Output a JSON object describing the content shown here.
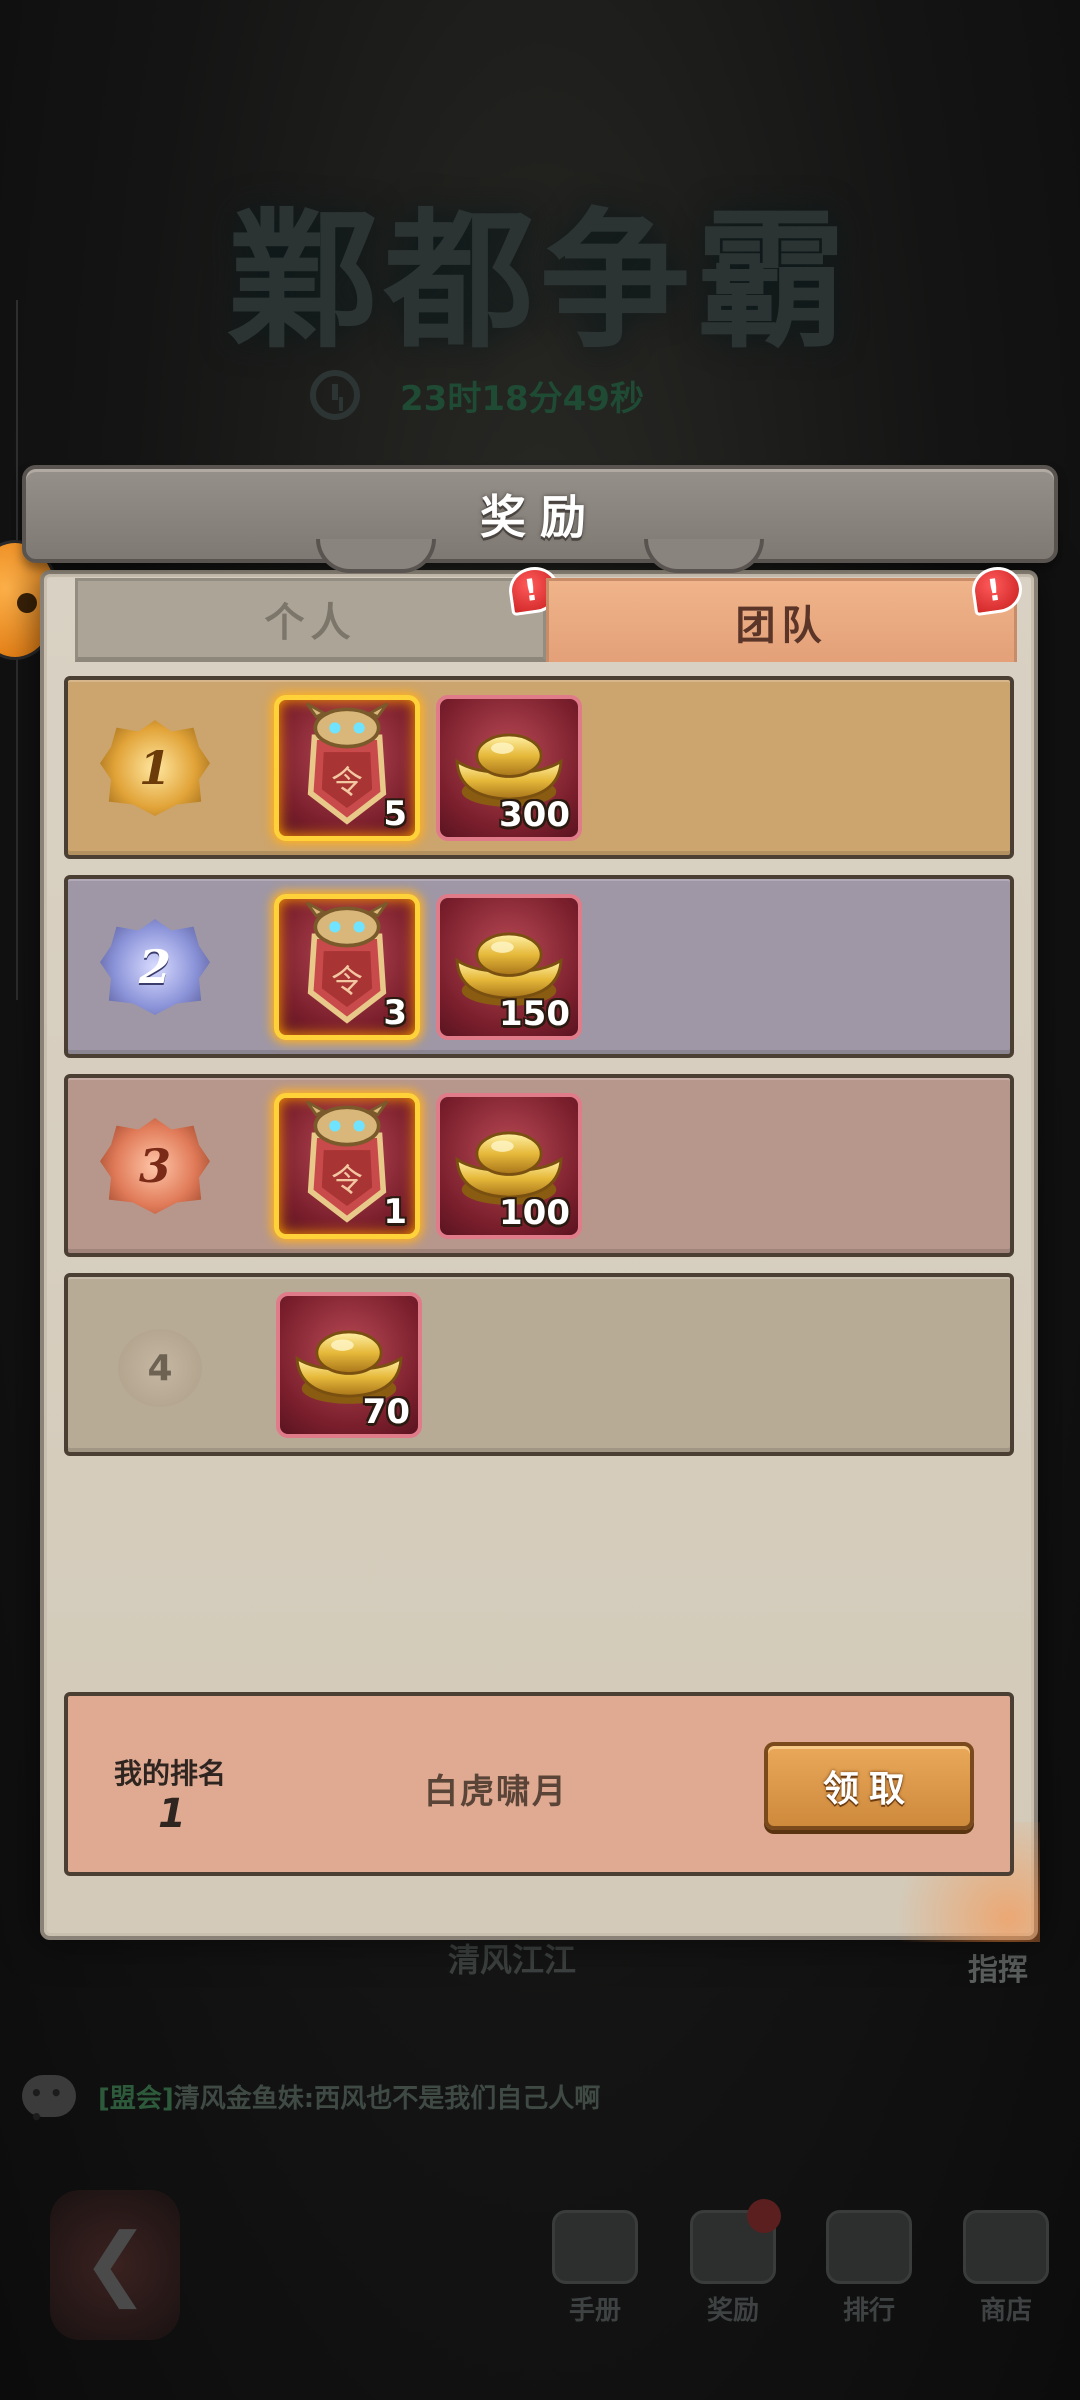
{
  "background": {
    "event_title": "鄴都争霸",
    "timer": "23时18分49秒",
    "team_name": "清风江江",
    "command_label": "指挥",
    "chat": {
      "channel": "[盟会]",
      "sender": "清风金鱼妹:",
      "message": "西风也不是我们自己人啊"
    },
    "nav": [
      {
        "label": "手册"
      },
      {
        "label": "奖励"
      },
      {
        "label": "排行"
      },
      {
        "label": "商店"
      }
    ]
  },
  "modal": {
    "title": "奖励",
    "tabs": [
      {
        "label": "个人",
        "active": false,
        "badge": "!"
      },
      {
        "label": "团队",
        "active": true,
        "badge": "!"
      }
    ],
    "rewards": [
      {
        "rank": "1",
        "items": [
          {
            "icon": "war-banner-shield-icon",
            "count": "5"
          },
          {
            "icon": "gold-ingot-icon",
            "count": "300"
          }
        ]
      },
      {
        "rank": "2",
        "items": [
          {
            "icon": "war-banner-shield-icon",
            "count": "3"
          },
          {
            "icon": "gold-ingot-icon",
            "count": "150"
          }
        ]
      },
      {
        "rank": "3",
        "items": [
          {
            "icon": "war-banner-shield-icon",
            "count": "1"
          },
          {
            "icon": "gold-ingot-icon",
            "count": "100"
          }
        ]
      },
      {
        "rank": "4",
        "items": [
          {
            "icon": "gold-ingot-icon",
            "count": "70"
          }
        ]
      }
    ],
    "my_rank": {
      "label": "我的排名",
      "value": "1",
      "team": "白虎啸月",
      "claim_label": "领取"
    }
  },
  "colors": {
    "row_gold": "#cca46d",
    "row_silver": "#9f97a5",
    "row_bronze": "#b7978c",
    "row_plain": "#b8ab96",
    "active_tab": "#e3a079",
    "claim_button": "#cf8a3c"
  }
}
